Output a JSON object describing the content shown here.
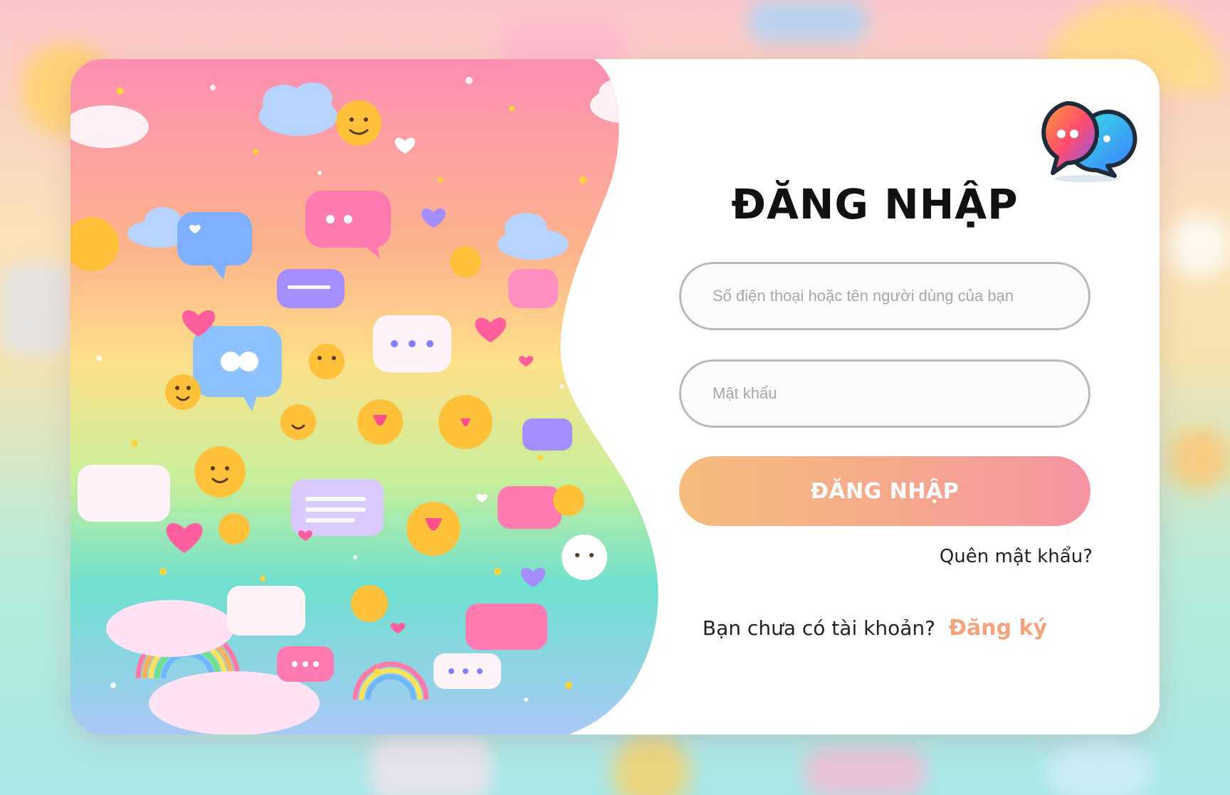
{
  "login": {
    "title": "ĐĂNG NHẬP",
    "username_placeholder": "Số điện thoại hoặc tên người dùng của bạn",
    "password_placeholder": "Mật khẩu",
    "submit_label": "ĐĂNG NHẬP",
    "forgot_label": "Quên mật khẩu?",
    "no_account_label": "Bạn chưa có tài khoản?",
    "signup_label": "Đăng ký"
  },
  "colors": {
    "accent_gradient_start": "#f5bd7c",
    "accent_gradient_end": "#f693a3",
    "signup_link": "#f4a37c"
  },
  "icons": {
    "logo": "chat-bubbles-logo-icon"
  }
}
